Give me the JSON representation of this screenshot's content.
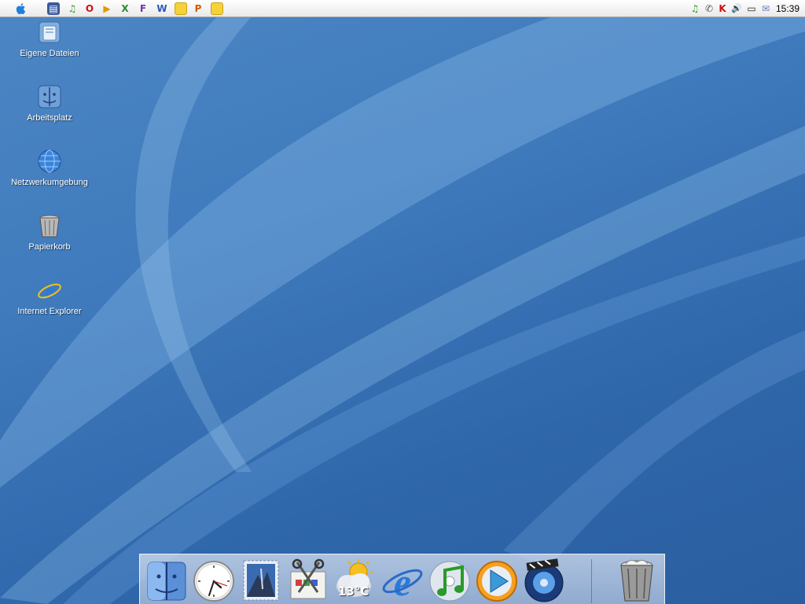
{
  "menubar": {
    "quicklaunch": [
      {
        "icon": "media-player-icon",
        "glyph": "▤"
      },
      {
        "icon": "itunes-icon",
        "glyph": "♫"
      },
      {
        "icon": "opera-icon",
        "glyph": "O"
      },
      {
        "icon": "media-play-icon",
        "glyph": "▶"
      },
      {
        "icon": "excel-icon",
        "glyph": "X"
      },
      {
        "icon": "frontpage-icon",
        "glyph": "F"
      },
      {
        "icon": "word-icon",
        "glyph": "W"
      },
      {
        "icon": "folder-icon",
        "glyph": ""
      },
      {
        "icon": "powerpoint-icon",
        "glyph": "P"
      },
      {
        "icon": "notes-icon",
        "glyph": ""
      }
    ],
    "tray": [
      {
        "icon": "itunes-tray-icon",
        "glyph": "♫"
      },
      {
        "icon": "network-tray-icon",
        "glyph": "✆"
      },
      {
        "icon": "antivirus-tray-icon",
        "glyph": "K"
      },
      {
        "icon": "volume-icon",
        "glyph": "🔊"
      },
      {
        "icon": "battery-icon",
        "glyph": "▭"
      },
      {
        "icon": "mail-icon",
        "glyph": "✉"
      }
    ],
    "clock": "15:39"
  },
  "desktop": {
    "icons": [
      {
        "label": "Eigene Dateien",
        "icon": "my-documents-icon"
      },
      {
        "label": "Arbeitsplatz",
        "icon": "my-computer-icon"
      },
      {
        "label": "Netzwerkumgebung",
        "icon": "network-icon"
      },
      {
        "label": "Papierkorb",
        "icon": "trash-icon"
      },
      {
        "label": "Internet Explorer",
        "icon": "internet-explorer-icon"
      }
    ]
  },
  "dock": {
    "items": [
      {
        "icon": "finder-icon"
      },
      {
        "icon": "clock-icon"
      },
      {
        "icon": "mail-stamp-icon"
      },
      {
        "icon": "scissors-icon"
      },
      {
        "icon": "weather-icon",
        "temperature": "13°C"
      },
      {
        "icon": "internet-explorer-icon"
      },
      {
        "icon": "itunes-icon"
      },
      {
        "icon": "quicktime-icon"
      },
      {
        "icon": "dvd-player-icon"
      },
      {
        "icon": "trash-icon"
      }
    ]
  },
  "colors": {
    "wallpaper": "#3f7bbd",
    "menubar": "#f2f2f2",
    "dock": "#c8d4e8"
  }
}
